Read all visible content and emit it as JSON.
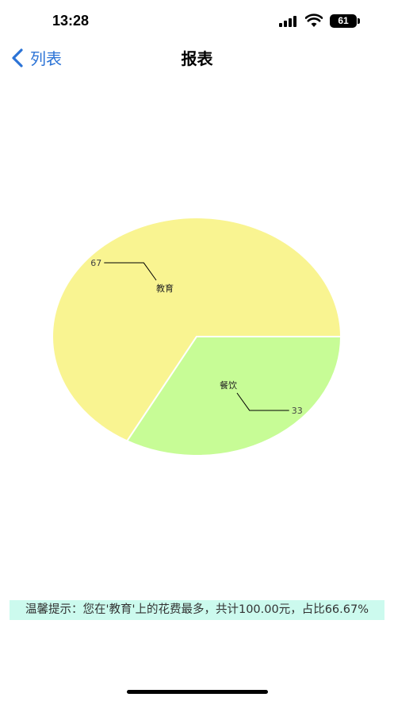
{
  "status_bar": {
    "time": "13:28",
    "battery": "61"
  },
  "nav": {
    "back_label": "列表",
    "title": "报表"
  },
  "chart_data": {
    "type": "pie",
    "slices": [
      {
        "label": "教育",
        "value": 67,
        "color": "#f9f491"
      },
      {
        "label": "餐饮",
        "value": 33,
        "color": "#c7fc96"
      }
    ]
  },
  "tip": "温馨提示：您在'教育'上的花费最多，共计100.00元，占比66.67%"
}
